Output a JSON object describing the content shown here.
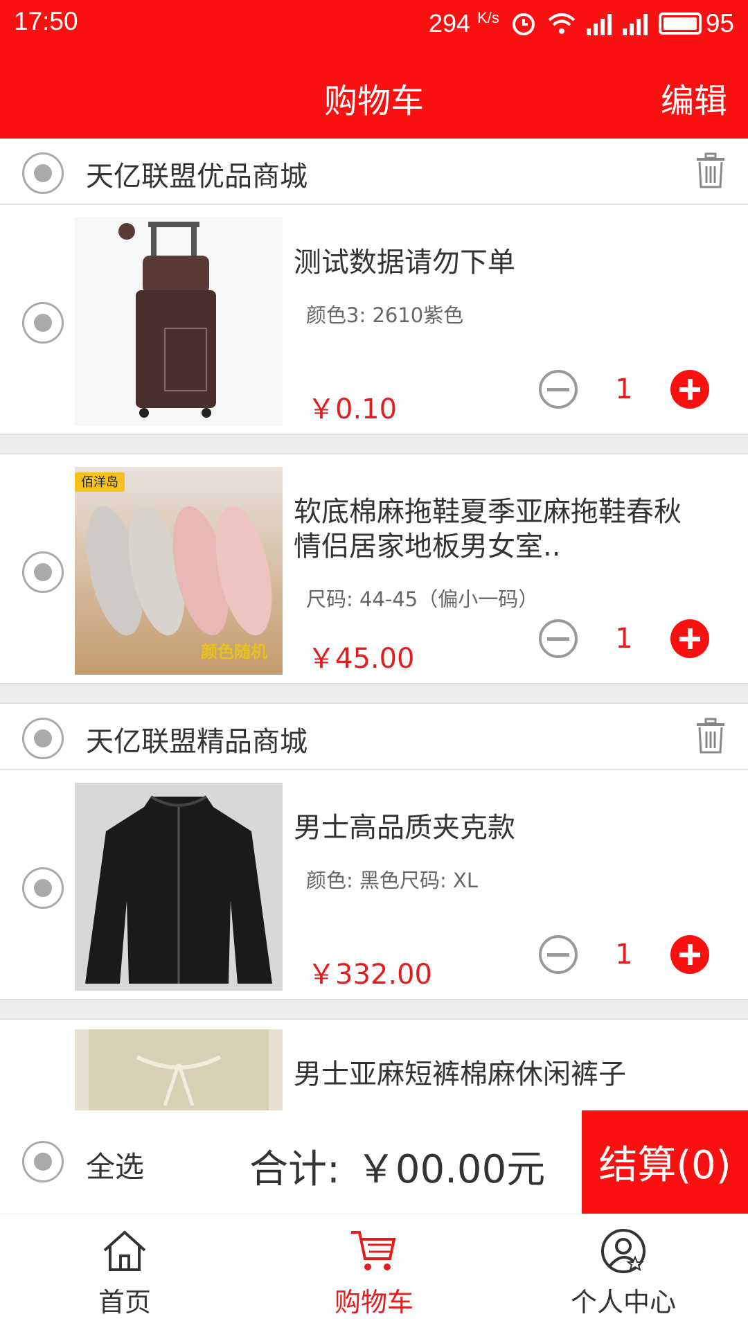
{
  "status_bar": {
    "time": "17:50",
    "speed": "294",
    "speed_unit": "K/s",
    "battery": "95"
  },
  "header": {
    "title": "购物车",
    "edit_label": "编辑"
  },
  "shops": [
    {
      "name": "天亿联盟优品商城",
      "items": [
        {
          "name": "测试数据请勿下单",
          "spec": "颜色3: 2610紫色",
          "price": "￥0.10",
          "qty": "1",
          "image": "luggage"
        },
        {
          "name": "软底棉麻拖鞋夏季亚麻拖鞋春秋情侣居家地板男女室..",
          "spec": "尺码: 44-45（偏小一码）",
          "price": "￥45.00",
          "qty": "1",
          "image": "slippers",
          "image_brand": "佰洋岛",
          "image_tag": "颜色随机"
        }
      ]
    },
    {
      "name": "天亿联盟精品商城",
      "items": [
        {
          "name": "男士高品质夹克款",
          "spec": "颜色: 黑色尺码: XL",
          "price": "￥332.00",
          "qty": "1",
          "image": "jacket"
        },
        {
          "name": "男士亚麻短裤棉麻休闲裤子",
          "image": "shorts"
        }
      ]
    }
  ],
  "checkout": {
    "select_all_label": "全选",
    "total_label": "合计:",
    "total_value": "￥00.00元",
    "settle_label": "结算(0)"
  },
  "nav": [
    {
      "label": "首页",
      "icon": "home-icon"
    },
    {
      "label": "购物车",
      "icon": "cart-icon",
      "active": true
    },
    {
      "label": "个人中心",
      "icon": "user-center-icon"
    }
  ],
  "colors": {
    "accent": "#f91010",
    "price": "#e31d1d"
  }
}
